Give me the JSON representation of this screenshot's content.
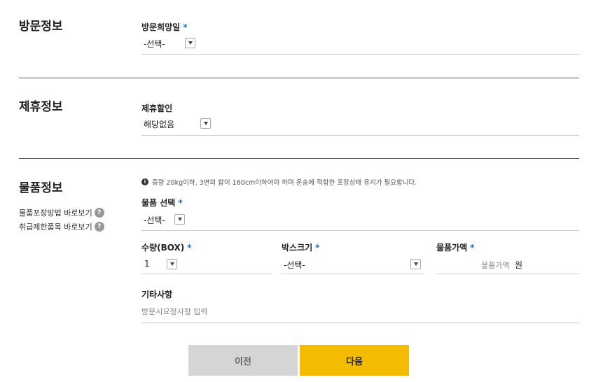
{
  "visit": {
    "title": "방문정보",
    "date_label": "방문희망일",
    "date_value": "-선택-"
  },
  "partner": {
    "title": "제휴정보",
    "discount_label": "제휴할인",
    "discount_value": "해당없음"
  },
  "goods": {
    "title": "물품정보",
    "side_links": [
      "물품포장방법 바로보기",
      "취급제한품목 바로보기"
    ],
    "notice": "중량 20kg이하, 3변의 합이 160cm이하여야 하며 운송에 적합한 포장상태 유지가 필요합니다.",
    "item_label": "물품 선택",
    "item_value": "-선택-",
    "qty_label": "수량(BOX)",
    "qty_value": "1",
    "box_label": "박스크기",
    "box_value": "-선택-",
    "price_label": "물품가액",
    "price_placeholder": "물품가액",
    "price_unit": "원",
    "etc_label": "기타사항",
    "etc_placeholder": "방문시요청사항 입력"
  },
  "required_mark": "*",
  "help_mark": "?",
  "info_mark": "i",
  "buttons": {
    "prev": "이전",
    "next": "다음"
  },
  "colors": {
    "accent": "#f3bc00",
    "required": "#1a73c8",
    "prev_bg": "#d5d5d5"
  }
}
